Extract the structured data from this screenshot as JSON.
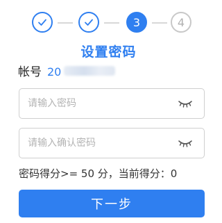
{
  "stepper": {
    "steps": [
      {
        "status": "done",
        "icon": "check-icon"
      },
      {
        "status": "done",
        "icon": "check-icon"
      },
      {
        "status": "active",
        "label": "3"
      },
      {
        "status": "todo",
        "label": "4"
      }
    ]
  },
  "title": "设置密码",
  "account": {
    "label": "帐号",
    "value_visible": "20"
  },
  "password_field": {
    "placeholder": "请输入密码",
    "value": "",
    "icon": "eye-closed-icon"
  },
  "confirm_field": {
    "placeholder": "请输入确认密码",
    "value": "",
    "icon": "eye-closed-icon"
  },
  "score_text": "密码得分>= 50 分，当前得分：0",
  "next_button_label": "下一步",
  "colors": {
    "accent": "#2f7ff0",
    "border": "#cfcfcf",
    "inactive": "#c8c8c8"
  }
}
